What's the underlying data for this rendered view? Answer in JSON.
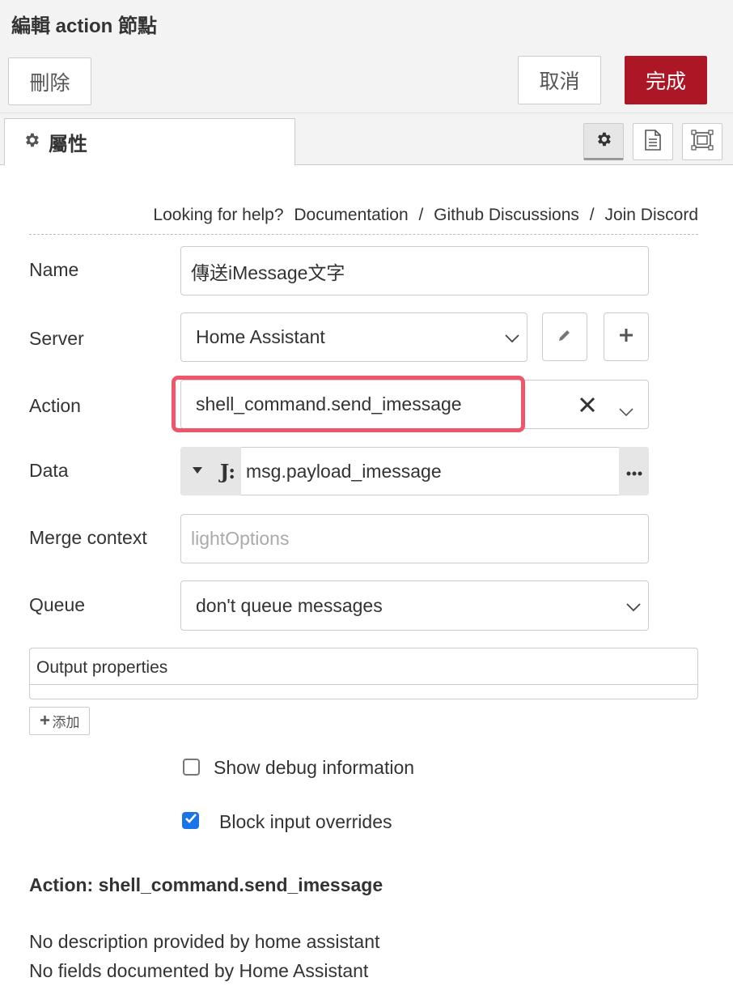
{
  "tray": {
    "title": "編輯 action 節點"
  },
  "toolbar": {
    "delete_label": "刪除",
    "cancel_label": "取消",
    "done_label": "完成"
  },
  "tabs": {
    "properties_label": "屬性"
  },
  "help": {
    "prefix": "Looking for help?",
    "links": [
      "Documentation",
      "Github Discussions",
      "Join Discord"
    ],
    "separator": "/"
  },
  "form": {
    "name": {
      "label": "Name",
      "value": "傳送iMessage文字"
    },
    "server": {
      "label": "Server",
      "value": "Home Assistant"
    },
    "action": {
      "label": "Action",
      "value": "shell_command.send_imessage"
    },
    "data": {
      "label": "Data",
      "type_icon": "J:",
      "value": "msg.payload_imessage"
    },
    "merge_context": {
      "label": "Merge context",
      "placeholder": "lightOptions"
    },
    "queue": {
      "label": "Queue",
      "value": "don't queue messages"
    }
  },
  "output": {
    "header": "Output properties",
    "add_label": "添加"
  },
  "options": {
    "debug": {
      "label": "Show debug information",
      "checked": false
    },
    "block": {
      "label": "Block input overrides",
      "checked": true
    }
  },
  "info": {
    "title": "Action: shell_command.send_imessage",
    "lines": [
      "No description provided by home assistant",
      "No fields documented by Home Assistant"
    ]
  },
  "colors": {
    "done_button": "#ad1625",
    "highlight": "#f0566a",
    "checkbox_checked": "#1a73e8"
  }
}
